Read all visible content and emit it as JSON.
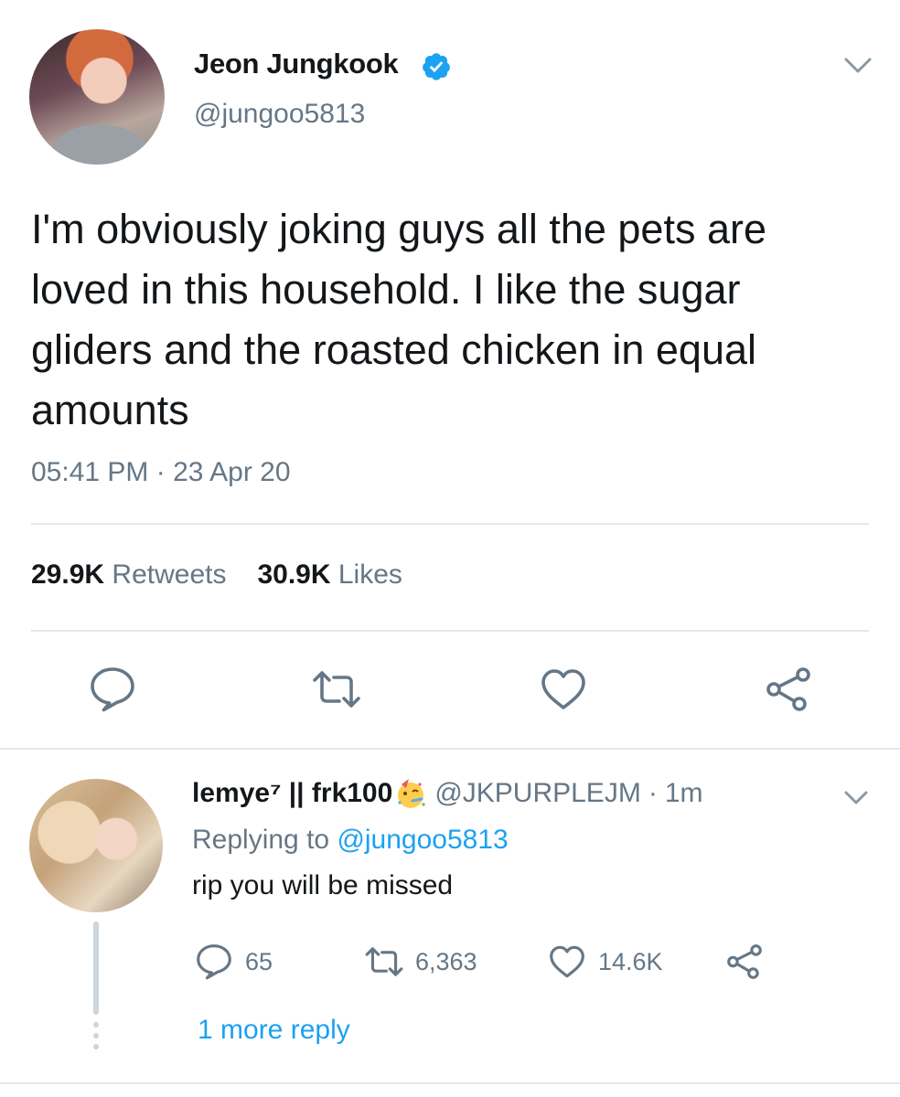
{
  "tweet": {
    "author_name": "Jeon Jungkook",
    "author_handle": "@jungoo5813",
    "verified": true,
    "text": "I'm obviously joking guys all the pets are loved in this household. I like the sugar gliders and the roasted chicken in equal amounts",
    "time": "05:41 PM",
    "date_separator": "·",
    "date": "23 Apr 20",
    "retweets_count": "29.9K",
    "retweets_label": "Retweets",
    "likes_count": "30.9K",
    "likes_label": "Likes",
    "actions": [
      "reply-icon",
      "retweet-icon",
      "like-icon",
      "share-icon"
    ]
  },
  "reply": {
    "author_name": "lemye⁷ || frk100",
    "emoji": "party-face-emoji",
    "author_handle": "@JKPURPLEJM",
    "separator": "·",
    "time": "1m",
    "replying_prefix": "Replying to",
    "replying_to": "@jungoo5813",
    "text": "rip you will be missed",
    "reply_count": "65",
    "retweet_count": "6,363",
    "like_count": "14.6K",
    "more_replies": "1 more reply"
  },
  "colors": {
    "text": "#14171a",
    "secondary": "#657786",
    "link": "#1da1f2",
    "divider": "#e1e8ed",
    "verified": "#1da1f2"
  }
}
